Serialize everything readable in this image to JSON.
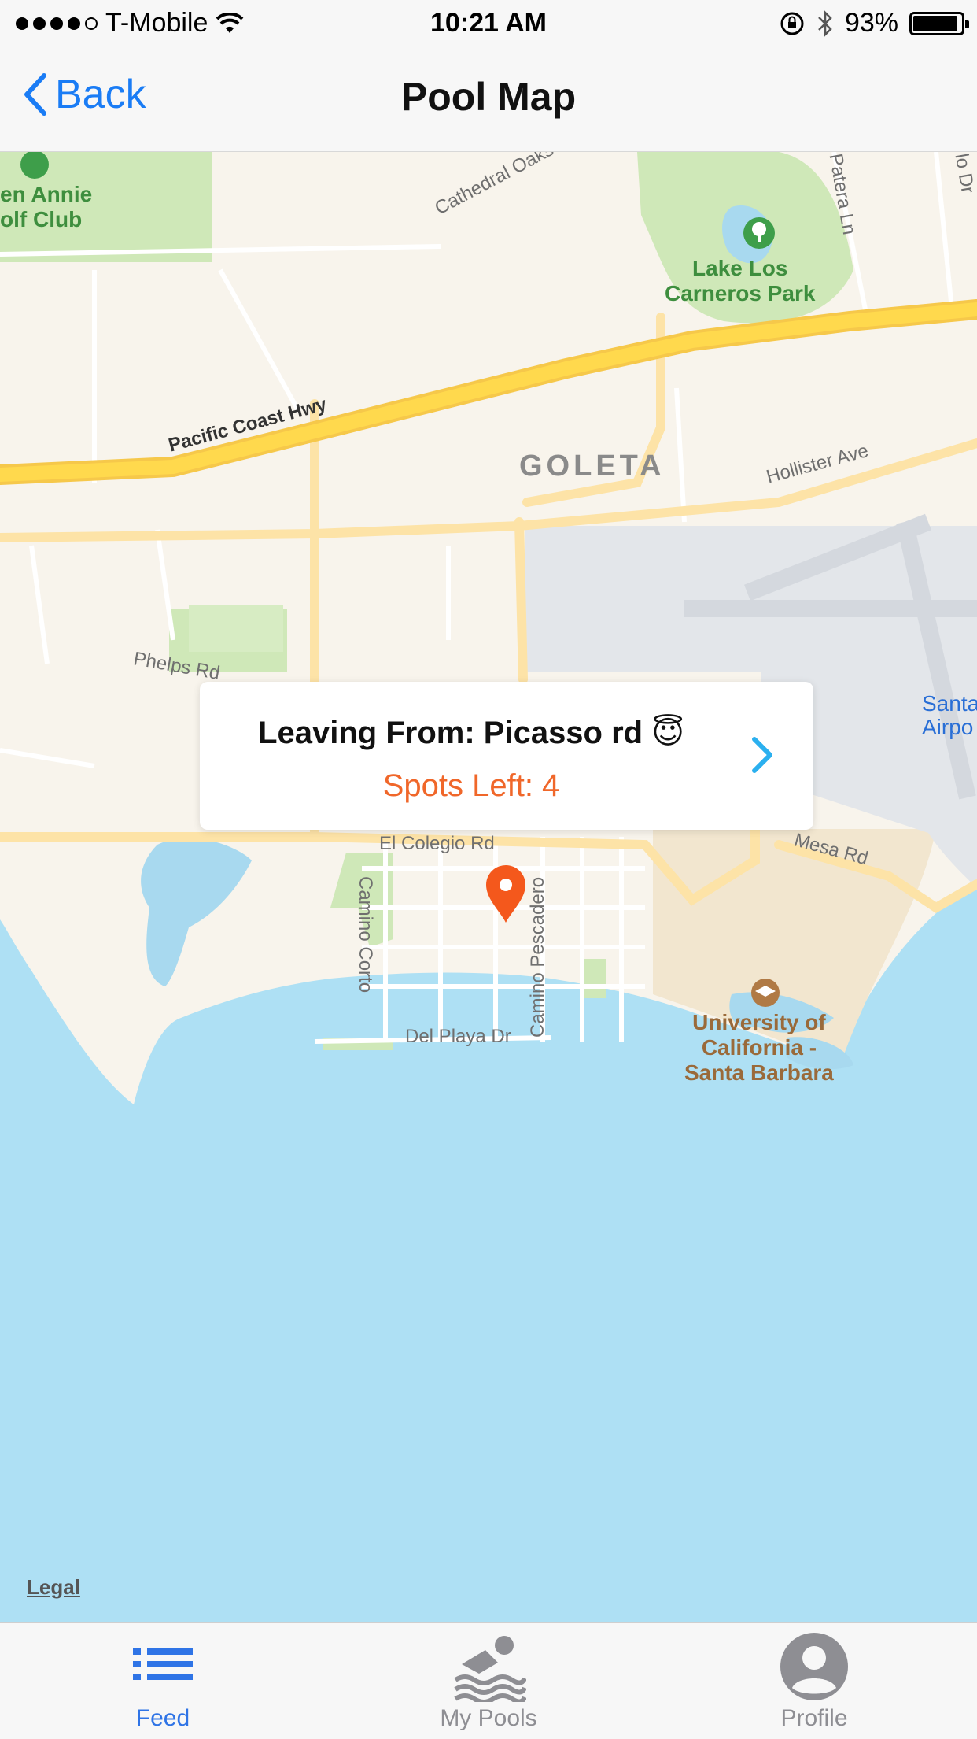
{
  "status_bar": {
    "carrier": "T-Mobile",
    "time": "10:21 AM",
    "battery": "93%",
    "battery_level": 0.93,
    "signal_bars_filled": 4,
    "signal_bars_total": 5
  },
  "nav": {
    "back_label": "Back",
    "title": "Pool Map"
  },
  "map": {
    "labels": {
      "golf": "en Annie\nolf Club",
      "park": "Lake Los\nCarneros Park",
      "city": "GOLETA",
      "airport": "Santa\nAirpo",
      "university": "University of\nCalifornia -\nSanta Barbara",
      "cathedral": "Cathedral Oaks Rd",
      "pch": "Pacific Coast Hwy",
      "hollister": "Hollister Ave",
      "phelps": "Phelps Rd",
      "colegio": "El Colegio Rd",
      "mesa": "Mesa Rd",
      "corto": "Camino Corto",
      "pescadero": "Camino Pescadero",
      "delplaya": "Del Playa Dr",
      "patera": "Patera Ln",
      "lodr": "lo Dr"
    },
    "legal": "Legal"
  },
  "callout": {
    "title": "Leaving From: Picasso rd 😇",
    "spots": "Spots Left: 4"
  },
  "tabs": [
    {
      "label": "Feed",
      "icon": "list-icon",
      "active": true
    },
    {
      "label": "My Pools",
      "icon": "swimmer-icon",
      "active": false
    },
    {
      "label": "Profile",
      "icon": "profile-icon",
      "active": false
    }
  ],
  "colors": {
    "accent": "#1a7cf5",
    "tab_active": "#2f74e6",
    "spots": "#f0672a",
    "pin": "#f4581c",
    "water": "#aee0f4",
    "land": "#f8f4ec",
    "highway": "#ffd94d"
  }
}
